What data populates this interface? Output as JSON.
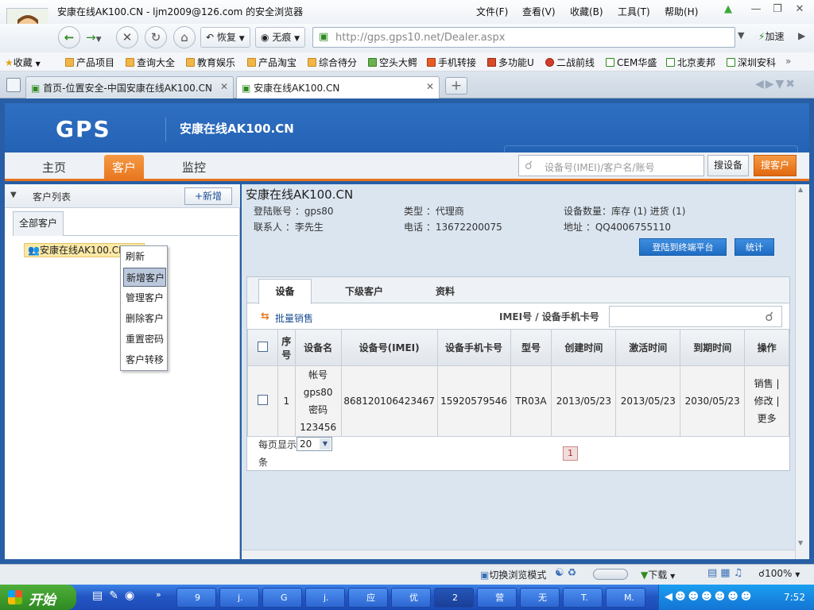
{
  "window": {
    "title": "安康在线AK100.CN - ljm2009@126.com 的安全浏览器",
    "menus": [
      "文件(F)",
      "查看(V)",
      "收藏(B)",
      "工具(T)",
      "帮助(H)"
    ]
  },
  "nav": {
    "restore_label": "恢复",
    "notrace_label": "无痕",
    "url": "http://gps.gps10.net/Dealer.aspx",
    "speedup_label": "加速"
  },
  "bookmarks": [
    "收藏",
    "产品项目",
    "查询大全",
    "教育娱乐",
    "产品淘宝",
    "综合待分",
    "空头大鳄",
    "手机转接",
    "多功能U",
    "二战前线",
    "CEM华盛",
    "北京麦邦",
    "深圳安科"
  ],
  "tabs": [
    {
      "label": "首页-位置安全-中国安康在线AK100.CN"
    },
    {
      "label": "安康在线AK100.CN"
    }
  ],
  "site": {
    "logo": "GPS",
    "name": "安康在线AK100.CN",
    "nav": [
      "主页",
      "客户",
      "监控"
    ],
    "search_placeholder": "设备号(IMEI)/客户名/账号",
    "search_device_btn": "搜设备",
    "search_customer_btn": "搜客户"
  },
  "left": {
    "header": "客户列表",
    "add_btn": "+新增",
    "tab": "全部客户",
    "tree_node": "安康在线AK100.CN",
    "context_menu": [
      "刷新",
      "新增客户",
      "管理客户",
      "删除客户",
      "重置密码",
      "客户转移"
    ]
  },
  "customer": {
    "name": "安康在线AK100.CN",
    "login": "登陆账号 ：gps80",
    "type": "类型 ：代理商",
    "device_count": "设备数量：库存 (1) 进货 (1)",
    "contact": "联系人 ：李先生",
    "phone": "电话 ：13672200075",
    "address": "地址 ：QQ4006755110",
    "btn_login_platform": "登陆到终端平台",
    "btn_stats": "统计"
  },
  "inner_tabs": [
    "设备",
    "下级客户",
    "资料"
  ],
  "toolbar": {
    "batch_sell": "批量销售",
    "search_label": "IMEI号 / 设备手机卡号"
  },
  "grid": {
    "headers": [
      "序号",
      "设备名",
      "设备号(IMEI)",
      "设备手机卡号",
      "型号",
      "创建时间",
      "激活时间",
      "到期时间",
      "操作"
    ],
    "rows": [
      {
        "no": "1",
        "name_lines": [
          "帐号",
          "gps80",
          "密码",
          "123456"
        ],
        "imei": "868120106423467",
        "sim": "15920579546",
        "model": "TR03A",
        "created": "2013/05/23",
        "activated": "2013/05/23",
        "expires": "2030/05/23",
        "ops": "销售 | 修改 | 更多"
      }
    ]
  },
  "pager": {
    "per_page_label": "每页显示",
    "per_page_value": "20",
    "unit": "条",
    "current_page": "1"
  },
  "status": {
    "switch_mode": "切换浏览模式",
    "download": "下载",
    "zoom": "100%"
  },
  "taskbar": {
    "start": "开始",
    "tasks": [
      "9",
      "j.",
      "G",
      "j.",
      "应",
      "优",
      "2",
      "营",
      "无",
      "T.",
      "M."
    ],
    "clock": "7:52"
  },
  "colors": {
    "site_blue": "#2462b4",
    "accent_orange": "#e8741d",
    "panel_bg": "#dbe5f0"
  }
}
